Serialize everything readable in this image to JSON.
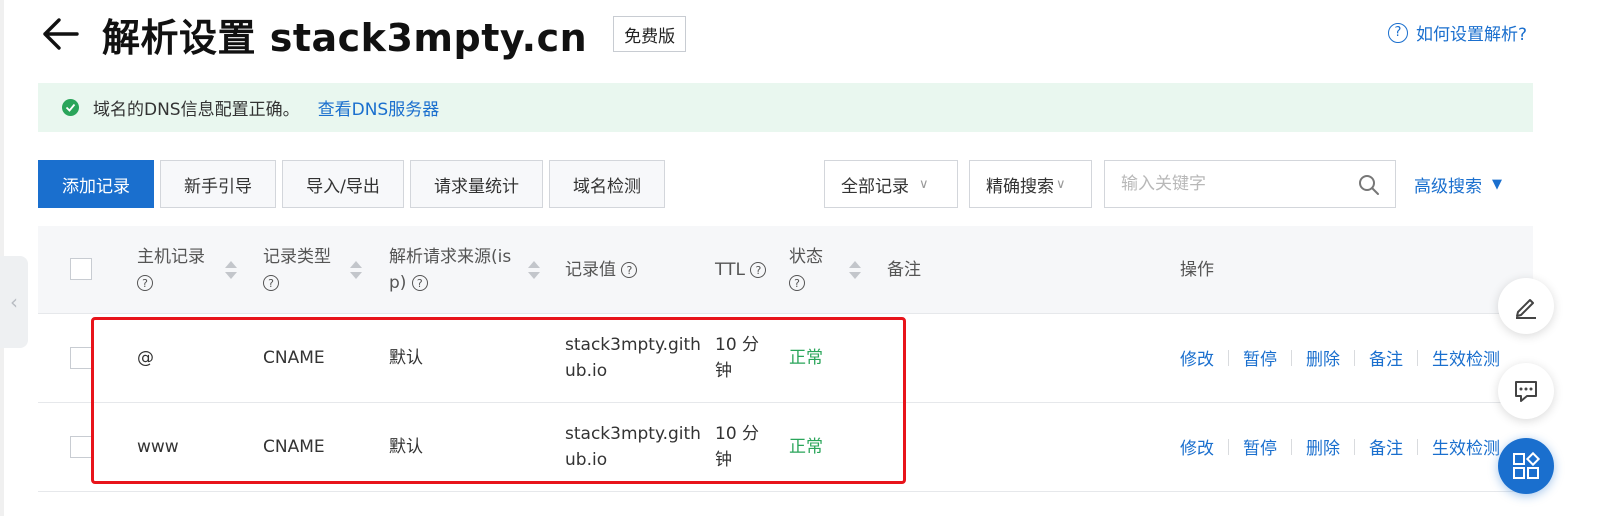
{
  "header": {
    "title": "解析设置 stack3mpty.cn",
    "edition": "免费版",
    "help_link": "如何设置解析?"
  },
  "notice": {
    "text": "域名的DNS信息配置正确。",
    "link": "查看DNS服务器"
  },
  "toolbar": {
    "add_record": "添加记录",
    "guide": "新手引导",
    "import_export": "导入/导出",
    "request_stats": "请求量统计",
    "domain_check": "域名检测",
    "filter_all": "全部记录",
    "filter_precise": "精确搜索",
    "search_placeholder": "输入关键字",
    "advanced_search": "高级搜索"
  },
  "table": {
    "columns": {
      "host": "主机记录",
      "type": "记录类型",
      "isp_line1": "解析请求来源(is",
      "isp_line2": "p)",
      "value": "记录值",
      "ttl": "TTL",
      "status": "状态",
      "remark": "备注",
      "ops": "操作"
    },
    "rows": [
      {
        "host": "@",
        "type": "CNAME",
        "isp": "默认",
        "value_line1": "stack3mpty.gith",
        "value_line2": "ub.io",
        "ttl_line1": "10 分",
        "ttl_line2": "钟",
        "status": "正常",
        "remark": "",
        "actions": {
          "edit": "修改",
          "pause": "暂停",
          "delete": "删除",
          "remark": "备注",
          "verify": "生效检测"
        }
      },
      {
        "host": "www",
        "type": "CNAME",
        "isp": "默认",
        "value_line1": "stack3mpty.gith",
        "value_line2": "ub.io",
        "ttl_line1": "10 分",
        "ttl_line2": "钟",
        "status": "正常",
        "remark": "",
        "actions": {
          "edit": "修改",
          "pause": "暂停",
          "delete": "删除",
          "remark": "备注",
          "verify": "生效检测"
        }
      }
    ]
  },
  "icons": {
    "help": "?",
    "qmark": "?",
    "collapse": "‹",
    "caret": "∨",
    "triangle": "▼"
  },
  "colors": {
    "accent": "#1a6fce",
    "success": "#2aa55a",
    "highlight": "#e8141b"
  }
}
